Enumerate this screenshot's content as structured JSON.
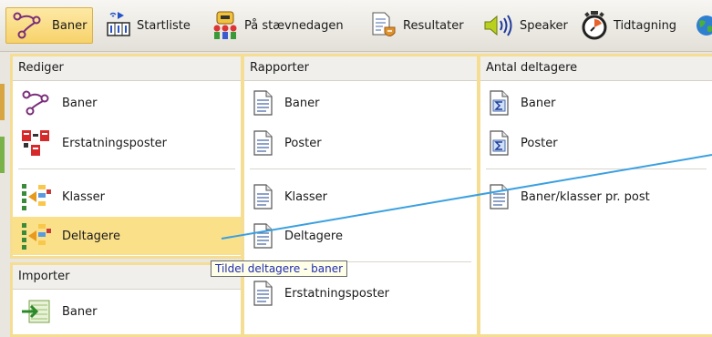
{
  "ribbon": {
    "tabs": [
      {
        "label": "Baner",
        "icon": "route-icon",
        "active": true
      },
      {
        "label": "Startliste",
        "icon": "startlist-icon",
        "active": false
      },
      {
        "label": "På stævnedagen",
        "icon": "people-icon",
        "active": false
      },
      {
        "label": "Resultater",
        "icon": "results-icon",
        "active": false
      },
      {
        "label": "Speaker",
        "icon": "speaker-icon",
        "active": false
      },
      {
        "label": "Tidtagning",
        "icon": "stopwatch-icon",
        "active": false
      }
    ]
  },
  "panels": {
    "rediger": {
      "title": "Rediger",
      "items": [
        {
          "label": "Baner",
          "icon": "route-icon"
        },
        {
          "label": "Erstatningsposter",
          "icon": "substitute-controls-icon"
        },
        {
          "label": "Klasser",
          "icon": "classes-icon"
        },
        {
          "label": "Deltagere",
          "icon": "participants-icon",
          "highlighted": true
        }
      ]
    },
    "importer": {
      "title": "Importer",
      "items": [
        {
          "label": "Baner",
          "icon": "import-icon"
        }
      ]
    },
    "rapporter": {
      "title": "Rapporter",
      "items": [
        {
          "label": "Baner",
          "icon": "document-icon"
        },
        {
          "label": "Poster",
          "icon": "document-icon"
        },
        {
          "label": "Klasser",
          "icon": "document-icon"
        },
        {
          "label": "Deltagere",
          "icon": "document-icon"
        },
        {
          "label": "Erstatningsposter",
          "icon": "document-icon"
        }
      ]
    },
    "antal": {
      "title": "Antal deltagere",
      "items": [
        {
          "label": "Baner",
          "icon": "sum-document-icon"
        },
        {
          "label": "Poster",
          "icon": "sum-document-icon"
        },
        {
          "label": "Baner/klasser pr. post",
          "icon": "document-icon"
        }
      ]
    }
  },
  "tooltip": "Tildel deltagere - baner",
  "colors": {
    "active_tab": "#f7d26a",
    "highlight": "#fbe08a",
    "panel_border": "#f5dd94",
    "tooltip_text": "#1e2bb5",
    "line": "#3aa0e0"
  }
}
